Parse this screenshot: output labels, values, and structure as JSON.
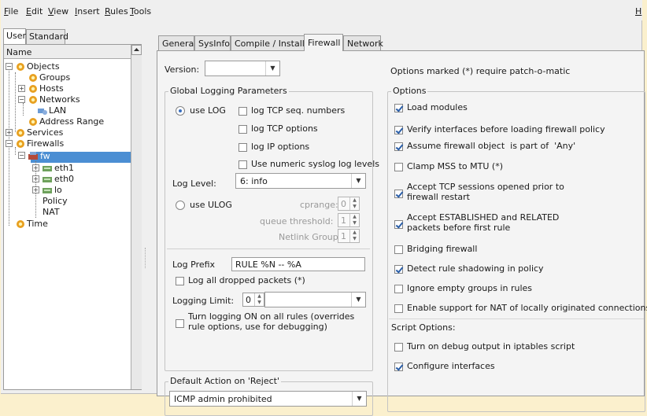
{
  "menu": {
    "items": [
      {
        "first": "F",
        "rest": "ile"
      },
      {
        "first": "E",
        "rest": "dit"
      },
      {
        "first": "V",
        "rest": "iew"
      },
      {
        "first": "I",
        "rest": "nsert"
      },
      {
        "first": "R",
        "rest": "ules"
      },
      {
        "first": "T",
        "rest": "ools"
      }
    ],
    "help_letter": "H"
  },
  "left_tabs": [
    "User",
    "Standard"
  ],
  "tree": {
    "header": "Name",
    "items": [
      {
        "label": "Objects"
      },
      {
        "label": "Groups"
      },
      {
        "label": "Hosts"
      },
      {
        "label": "Networks"
      },
      {
        "label": "LAN"
      },
      {
        "label": "Address Range"
      },
      {
        "label": "Services"
      },
      {
        "label": "Firewalls"
      },
      {
        "label": "fw"
      },
      {
        "label": "eth1"
      },
      {
        "label": "eth0"
      },
      {
        "label": "lo"
      },
      {
        "label": "Policy"
      },
      {
        "label": "NAT"
      },
      {
        "label": "Time"
      }
    ]
  },
  "tabs": [
    "General",
    "SysInfo",
    "Compile / Install",
    "Firewall",
    "Network"
  ],
  "active_tab": "Firewall",
  "version": {
    "label": "Version:",
    "value": ""
  },
  "patch_note": "Options marked (*) require patch-o-matic",
  "logging": {
    "title": "Global Logging Parameters",
    "use_log": "use LOG",
    "log_tcp_seq": "log TCP seq. numbers",
    "log_tcp_options": "log TCP options",
    "log_ip_options": "log IP options",
    "numeric_syslog": "Use numeric syslog log levels",
    "log_level_label": "Log Level:",
    "log_level_value": "6: info",
    "use_ulog": "use ULOG",
    "cprange_label": "cprange:",
    "cprange_value": "0",
    "queue_label": "queue threshold:",
    "queue_value": "1",
    "netlink_label": "Netlink Group:",
    "netlink_value": "1",
    "log_prefix_label": "Log Prefix",
    "log_prefix_value": "RULE %N -- %A",
    "log_dropped": "Log all dropped packets (*)",
    "limit_label": "Logging Limit:",
    "limit_value": "0",
    "limit_unit": "",
    "turn_logging_line1": "Turn logging ON on all rules (overrides",
    "turn_logging_line2": "rule options, use for debugging)"
  },
  "reject": {
    "title": "Default Action on 'Reject'",
    "value": "ICMP admin prohibited"
  },
  "options": {
    "title": "Options",
    "items": [
      {
        "label": "Load modules",
        "checked": true
      },
      {
        "label": "Verify interfaces before loading firewall policy",
        "checked": true
      },
      {
        "label": "Assume firewall object  is part of  'Any'",
        "checked": true
      },
      {
        "label": "Clamp MSS to MTU (*)",
        "checked": false
      },
      {
        "label": "Accept TCP sessions opened prior to",
        "label2": "firewall restart",
        "checked": true
      },
      {
        "label": "Accept ESTABLISHED and RELATED",
        "label2": "packets before first rule",
        "checked": true
      },
      {
        "label": "Bridging firewall",
        "checked": false
      },
      {
        "label": "Detect rule shadowing in policy",
        "checked": true
      },
      {
        "label": "Ignore empty groups in rules",
        "checked": false
      },
      {
        "label": "Enable support for NAT of locally originated connections",
        "checked": false
      }
    ]
  },
  "script_options": {
    "title": "Script Options:",
    "items": [
      {
        "label": "Turn on debug output in iptables script",
        "checked": false
      },
      {
        "label": "Configure interfaces",
        "checked": true
      }
    ]
  },
  "colors": {
    "background": "#fbf0cd",
    "selection": "#4b8ed3",
    "panel": "#f4f4f4"
  }
}
